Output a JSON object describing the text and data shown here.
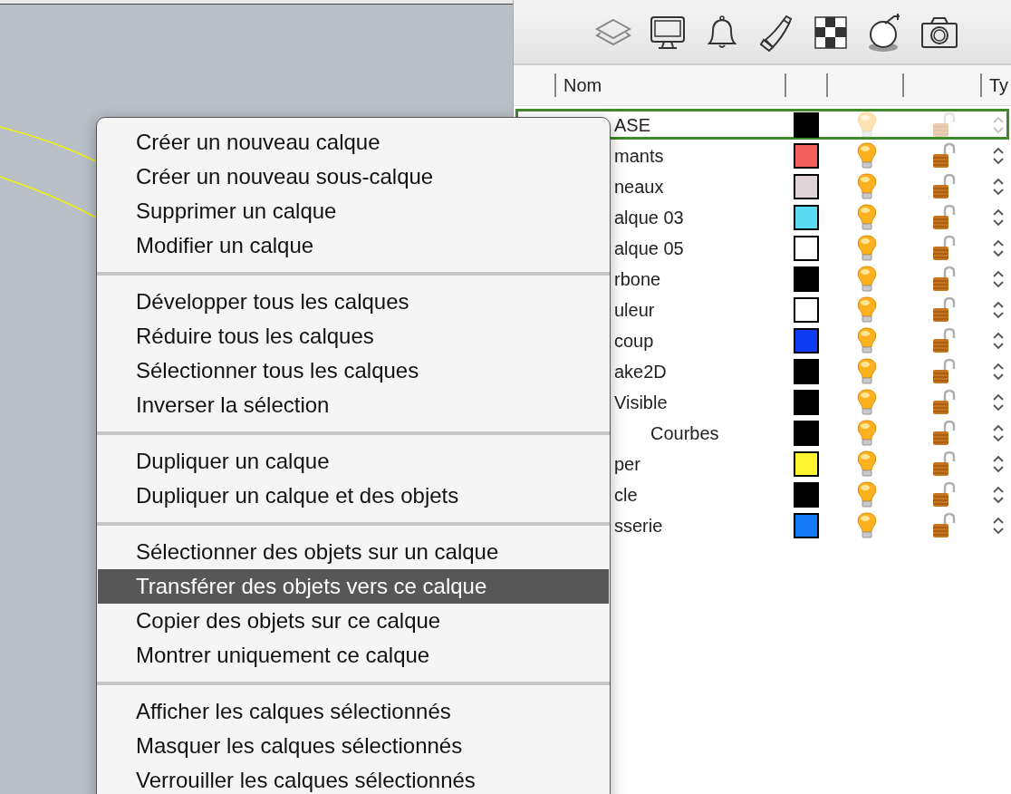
{
  "layers_panel": {
    "columns": [
      {
        "label": "Nom"
      },
      {
        "label": "Ty"
      }
    ],
    "layers": [
      {
        "name": "ASE",
        "color": "#000000",
        "selected": true
      },
      {
        "name": "mants",
        "color": "#f25f5c",
        "selected": false
      },
      {
        "name": "neaux",
        "color": "#e0d3d8",
        "selected": false
      },
      {
        "name": "alque 03",
        "color": "#5bdcf5",
        "selected": false
      },
      {
        "name": "alque 05",
        "color": "#ffffff",
        "selected": false
      },
      {
        "name": "rbone",
        "color": "#000000",
        "selected": false
      },
      {
        "name": "uleur",
        "color": "#ffffff",
        "selected": false
      },
      {
        "name": "coup",
        "color": "#0d3cf5",
        "selected": false
      },
      {
        "name": "ake2D",
        "color": "#000000",
        "selected": false
      },
      {
        "name": "Visible",
        "color": "#000000",
        "selected": false,
        "children": [
          {
            "name": "Courbes",
            "color": "#000000",
            "selected": false
          }
        ]
      },
      {
        "name": "per",
        "color": "#fff430",
        "selected": false
      },
      {
        "name": "cle",
        "color": "#000000",
        "selected": false
      },
      {
        "name": "sserie",
        "color": "#1379f5",
        "selected": false
      }
    ]
  },
  "context_menu": {
    "groups": [
      [
        {
          "label": "Créer un nouveau calque",
          "selected": false
        },
        {
          "label": "Créer un nouveau sous-calque",
          "selected": false
        },
        {
          "label": "Supprimer un calque",
          "selected": false
        },
        {
          "label": "Modifier un calque",
          "selected": false
        }
      ],
      [
        {
          "label": "Développer tous les calques",
          "selected": false
        },
        {
          "label": "Réduire tous les calques",
          "selected": false
        },
        {
          "label": "Sélectionner tous les calques",
          "selected": false
        },
        {
          "label": "Inverser la sélection",
          "selected": false
        }
      ],
      [
        {
          "label": "Dupliquer un calque",
          "selected": false
        },
        {
          "label": "Dupliquer un calque et des objets",
          "selected": false
        }
      ],
      [
        {
          "label": "Sélectionner des objets sur un calque",
          "selected": false
        },
        {
          "label": "Transférer des objets vers ce calque",
          "selected": true
        },
        {
          "label": "Copier des objets sur ce calque",
          "selected": false
        },
        {
          "label": "Montrer uniquement ce calque",
          "selected": false
        }
      ],
      [
        {
          "label": "Afficher les calques sélectionnés",
          "selected": false
        },
        {
          "label": "Masquer les calques sélectionnés",
          "selected": false
        },
        {
          "label": "Verrouiller les calques sélectionnés",
          "selected": false
        }
      ]
    ]
  }
}
